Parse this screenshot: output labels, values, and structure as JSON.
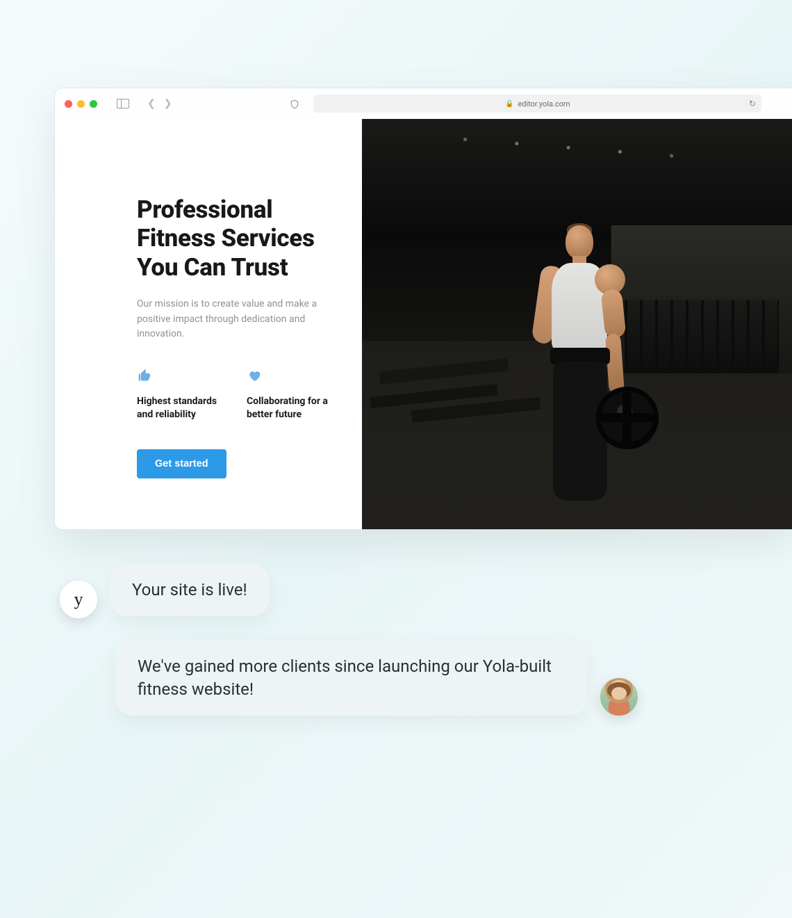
{
  "browser": {
    "url": "editor.yola.com"
  },
  "hero": {
    "title": "Professional Fitness Services You Can Trust",
    "subtitle": "Our mission is to create value and make a positive impact through dedication and innovation.",
    "features": [
      {
        "label": "Highest standards and reliability"
      },
      {
        "label": "Collaborating for a better future"
      }
    ],
    "cta_label": "Get started"
  },
  "chat": {
    "yola_avatar_glyph": "y",
    "message_1": "Your site is live!",
    "message_2": "We've gained more clients since launching our Yola-built fitness website!"
  }
}
